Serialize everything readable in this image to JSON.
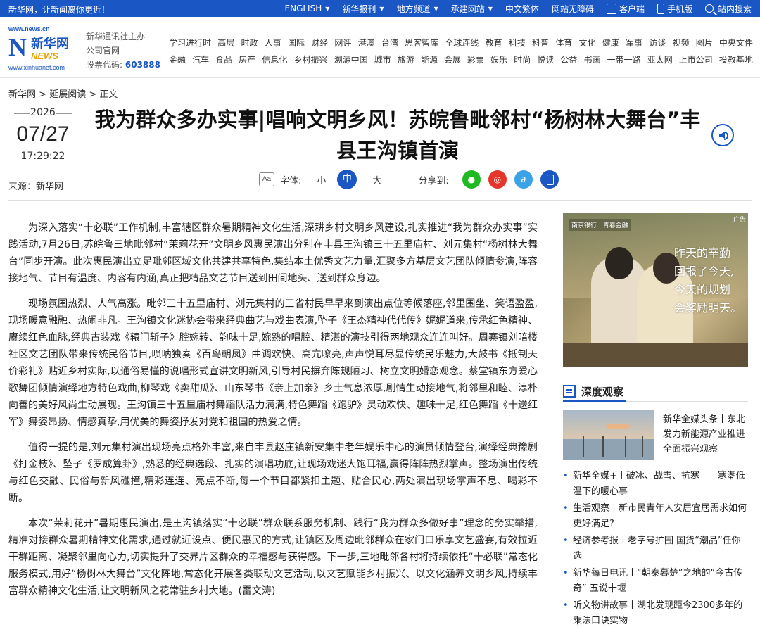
{
  "topbar": {
    "slogan": "新华网，让新闻离你更近！",
    "links": [
      {
        "label": "ENGLISH",
        "caret": true
      },
      {
        "label": "新华报刊",
        "caret": true
      },
      {
        "label": "地方频道",
        "caret": true
      },
      {
        "label": "承建网站",
        "caret": true
      },
      {
        "label": "中文繁体",
        "caret": false
      },
      {
        "label": "网站无障碍",
        "caret": false
      }
    ],
    "client": "客户端",
    "mobile": "手机版",
    "search": "站内搜索"
  },
  "header": {
    "logo_url_top": "www.news.cn",
    "logo_cn": "新华网",
    "logo_news": "NEWS",
    "logo_url_bottom": "www.xinhuanet.com",
    "org_line1": "新华通讯社主办",
    "org_line2": "公司官网",
    "stock_label": "股票代码:",
    "stock_code": "603888"
  },
  "nav": {
    "row1": [
      "学习进行时",
      "高层",
      "时政",
      "人事",
      "国际",
      "财经",
      "网评",
      "港澳",
      "台湾",
      "思客智库",
      "全球连线",
      "教育",
      "科技",
      "科普",
      "体育",
      "文化",
      "健康",
      "军事",
      "访谈",
      "视频",
      "图片",
      "中央文件"
    ],
    "row2": [
      "金融",
      "汽车",
      "食品",
      "房产",
      "信息化",
      "乡村振兴",
      "溯源中国",
      "城市",
      "旅游",
      "能源",
      "会展",
      "彩票",
      "娱乐",
      "时尚",
      "悦读",
      "公益",
      "书画",
      "一带一路",
      "亚太网",
      "上市公司",
      "投教基地"
    ]
  },
  "breadcrumb": {
    "home": "新华网",
    "sep1": " > ",
    "section": "延展阅读",
    "sep2": " > ",
    "current": "正文"
  },
  "meta": {
    "year": "2026",
    "month_day": "07/27",
    "time": "17:29:22",
    "source": "来源：新华网"
  },
  "article": {
    "title": "我为群众多办实事|唱响文明乡风！苏皖鲁毗邻村“杨树林大舞台”丰县王沟镇首演",
    "font_label": "字体:",
    "font_small": "小",
    "font_medium": "中",
    "font_large": "大",
    "share_label": "分享到:",
    "paragraphs": [
      "为深入落实“十必联”工作机制,丰富辖区群众暑期精神文化生活,深耕乡村文明乡风建设,扎实推进“我为群众办实事”实践活动,7月26日,苏皖鲁三地毗邻村“茉莉花开”文明乡风惠民演出分别在丰县王沟镇三十五里庙村、刘元集村“杨树林大舞台”同步开演。此次惠民演出立足毗邻区域文化共建共享特色,集结本土优秀文艺力量,汇聚多方基层文艺团队倾情参演,阵容接地气、节目有温度、内容有内涵,真正把精品文艺节目送到田间地头、送到群众身边。",
      "现场氛围热烈、人气高涨。毗邻三十五里庙村、刘元集村的三省村民早早来到演出点位等候落座,邻里围坐、笑语盈盈,现场暖意融融、热闹非凡。王沟镇文化迷协会带来经典曲艺与戏曲表演,坠子《王杰精神代代传》娓娓道来,传承红色精神、赓续红色血脉,经典古装戏《辕门斩子》腔婉转、韵味十足,婉熟的唱腔、精湛的演技引得两地观众连连叫好。周寨镇刘暗楼社区文艺团队带来传统民俗节目,唢呐独奏《百鸟朝凤》曲调欢快、高亢嘹亮,声声悦耳尽显传统民乐魅力,大鼓书《抵制天价彩礼》贴近乡村实际,以通俗易懂的说唱形式宣讲文明新风,引导村民摒弃陈规陋习、树立文明婚恋观念。蔡堂镇东方爱心歌舞团倾情演绎地方特色戏曲,柳琴戏《卖甜瓜》、山东琴书《亲上加亲》乡土气息浓厚,剧情生动接地气,将邻里和睦、淳朴向善的美好风尚生动展现。王沟镇三十五里庙村舞蹈队活力满满,特色舞蹈《跑驴》灵动欢快、趣味十足,红色舞蹈《十送红军》舞姿昂扬、情感真挚,用优美的舞姿抒发对党和祖国的热爱之情。",
      "值得一提的是,刘元集村演出现场亮点格外丰富,来自丰县赵庄镇新安集中老年娱乐中心的演员倾情登台,演绎经典豫剧《打金枝》、坠子《罗成算卦》,熟悉的经典选段、扎实的演唱功底,让现场戏迷大饱耳福,赢得阵阵热烈掌声。整场演出传统与红色交融、民俗与新风碰撞,精彩连连、亮点不断,每一个节目都紧扣主题、贴合民心,两处演出现场掌声不息、喝彩不断。",
      "本次“茉莉花开”暑期惠民演出,是王沟镇落实“十必联”群众联系服务机制、践行“我为群众多做好事”理念的务实举措,精准对接群众暑期精神文化需求,通过就近设点、便民惠民的方式,让镇区及周边毗邻群众在家门口乐享文艺盛宴,有效拉近干群距离、凝聚邻里向心力,切实提升了交界片区群众的幸福感与获得感。下一步,三地毗邻各村将持续依托“十必联”常态化服务模式,用好“杨树林大舞台”文化阵地,常态化开展各类联动文艺活动,以文艺赋能乡村振兴、以文化涵养文明乡风,持续丰富群众精神文化生活,让文明新风之花常驻乡村大地。(雷文涛)"
    ]
  },
  "ad": {
    "bank": "南京银行 | 青春金融",
    "tag": "广告",
    "copy_lines": [
      "昨天的辛勤",
      "回报了今天,",
      "今天的规划",
      "会奖励明天。"
    ]
  },
  "sidebar": {
    "section_title": "深度观察",
    "feature_text": "新华全媒头条丨东北发力新能源产业推进全面振兴观察",
    "items": [
      "新华全媒+丨破冰、战雪、抗寒——寒潮低温下的暖心事",
      "生活观察丨新市民青年人安居宜居需求如何更好满足?",
      "经济参考报丨老字号扩围 国货“潮品”任你选",
      "新华每日电讯丨“朝秦暮楚”之地的“今古传奇” 五说十堰",
      "听文物讲故事丨湖北发现距今2300多年的乘法口诀实物"
    ]
  },
  "colors": {
    "brand_blue": "#1a56c4",
    "wechat_green": "#1fb922",
    "weibo_red": "#e6352a",
    "link_blue": "#3aa2e6"
  },
  "icons": {
    "client": "tablet-icon",
    "mobile": "phone-icon",
    "search": "search-icon",
    "audio": "speaker-icon",
    "font": "font-size-icon",
    "share": [
      "wechat-icon",
      "weibo-icon",
      "link-icon",
      "mobile-share-icon"
    ],
    "section": "book-icon"
  }
}
